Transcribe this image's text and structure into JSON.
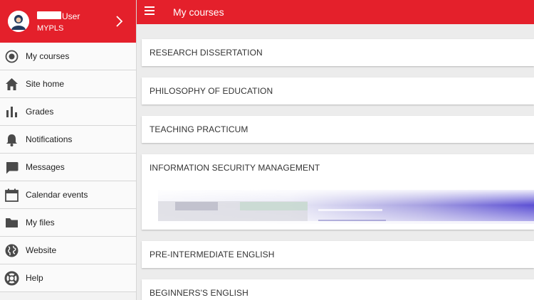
{
  "sidebar": {
    "profile": {
      "user_name": "User",
      "site_name": "MYPLS"
    },
    "items": [
      {
        "label": "My courses",
        "icon": "radio-selected-icon"
      },
      {
        "label": "Site home",
        "icon": "home-icon"
      },
      {
        "label": "Grades",
        "icon": "bar-chart-icon"
      },
      {
        "label": "Notifications",
        "icon": "bell-icon"
      },
      {
        "label": "Messages",
        "icon": "chat-icon"
      },
      {
        "label": "Calendar events",
        "icon": "calendar-icon"
      },
      {
        "label": "My files",
        "icon": "folder-icon"
      },
      {
        "label": "Website",
        "icon": "globe-icon"
      },
      {
        "label": "Help",
        "icon": "lifebuoy-icon"
      }
    ]
  },
  "header": {
    "title": "My courses"
  },
  "courses": [
    {
      "name": "RESEARCH DISSERTATION"
    },
    {
      "name": "PHILOSOPHY OF EDUCATION"
    },
    {
      "name": "TEACHING PRACTICUM"
    },
    {
      "name": "INFORMATION SECURITY MANAGEMENT"
    },
    {
      "name": "PRE-INTERMEDIATE ENGLISH"
    },
    {
      "name": "BEGINNERS'S ENGLISH"
    }
  ],
  "colors": {
    "brand": "#e4202b",
    "icon": "#4a4a4a"
  }
}
